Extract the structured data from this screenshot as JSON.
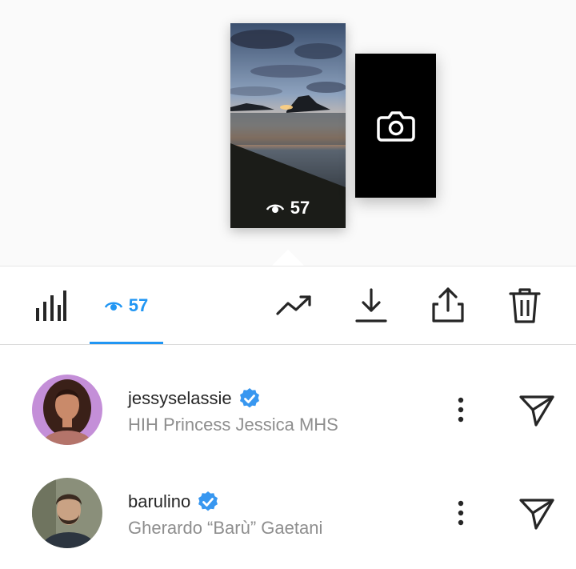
{
  "story": {
    "view_count": "57",
    "icons": {
      "eye": "eye-icon",
      "camera": "camera-icon"
    }
  },
  "toolbar": {
    "views_label": "57",
    "icons": [
      "insights-icon",
      "eye-icon",
      "trending-up-icon",
      "download-icon",
      "share-icon",
      "trash-icon"
    ],
    "accent_color": "#2196f3"
  },
  "viewers": [
    {
      "username": "jessyselassie",
      "full_name": "HIH Princess Jessica MHS",
      "verified": true
    },
    {
      "username": "barulino",
      "full_name": "Gherardo “Barù” Gaetani",
      "verified": true
    }
  ],
  "colors": {
    "verified_badge": "#3897f0",
    "secondary_text": "#8e8e8e",
    "primary_text": "#262626"
  }
}
